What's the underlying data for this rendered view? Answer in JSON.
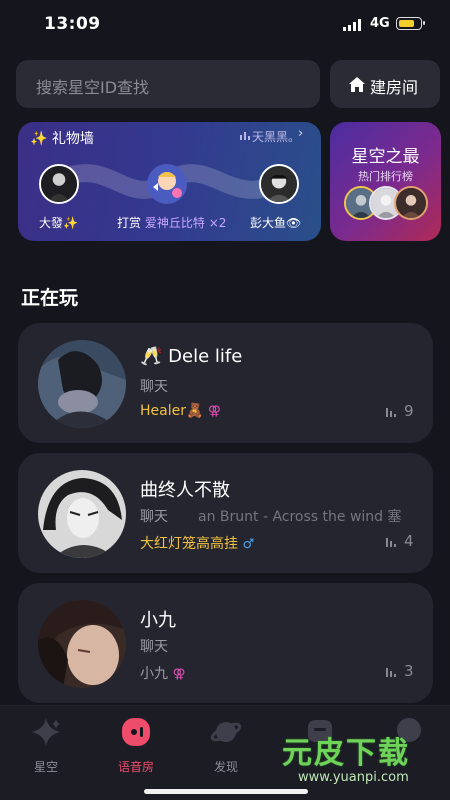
{
  "status_bar": {
    "time": "13:09",
    "network": "4G",
    "battery_level": 0.75
  },
  "search": {
    "placeholder": "搜索星空ID查找",
    "create_room_label": "建房间"
  },
  "gift_wall": {
    "title": "礼物墙",
    "title_icon": "sparkle-icon",
    "ticker_text": "天黑黑。",
    "sender_name": "大發✨",
    "action_prefix": "打赏",
    "gift_name": "爱神丘比特",
    "gift_count": "×2",
    "receiver_name": "彭大鱼👁"
  },
  "rank_card": {
    "title": "星空之最",
    "subtitle": "热门排行榜"
  },
  "section": {
    "title": "正在玩"
  },
  "rooms": [
    {
      "name": "🥂 Dele life",
      "type": "聊天",
      "song": "",
      "host": "Healer🧸",
      "host_style": "gold",
      "gender": "female",
      "count": "9"
    },
    {
      "name": "曲终人不散",
      "type": "聊天",
      "song": "an Brunt - Across the wind   塞",
      "host": "大红灯笼高高挂",
      "host_style": "gold",
      "gender": "male",
      "count": "4"
    },
    {
      "name": "小九",
      "type": "聊天",
      "song": "",
      "host": "小九",
      "host_style": "muted",
      "gender": "female",
      "count": "3"
    }
  ],
  "tabs": [
    {
      "label": "星空",
      "icon": "sparkle-tab-icon",
      "active": false
    },
    {
      "label": "语音房",
      "icon": "voice-room-icon",
      "active": true
    },
    {
      "label": "发现",
      "icon": "planet-icon",
      "active": false
    },
    {
      "label": "",
      "icon": "message-icon",
      "active": false
    },
    {
      "label": "",
      "icon": "profile-icon",
      "active": false
    }
  ],
  "watermark": {
    "text": "元皮下载",
    "url": "www.yuanpi.com"
  },
  "colors": {
    "background": "#15151d",
    "accent": "#ef4b6b",
    "gold": "#f1c23f",
    "card": "#25252f"
  }
}
